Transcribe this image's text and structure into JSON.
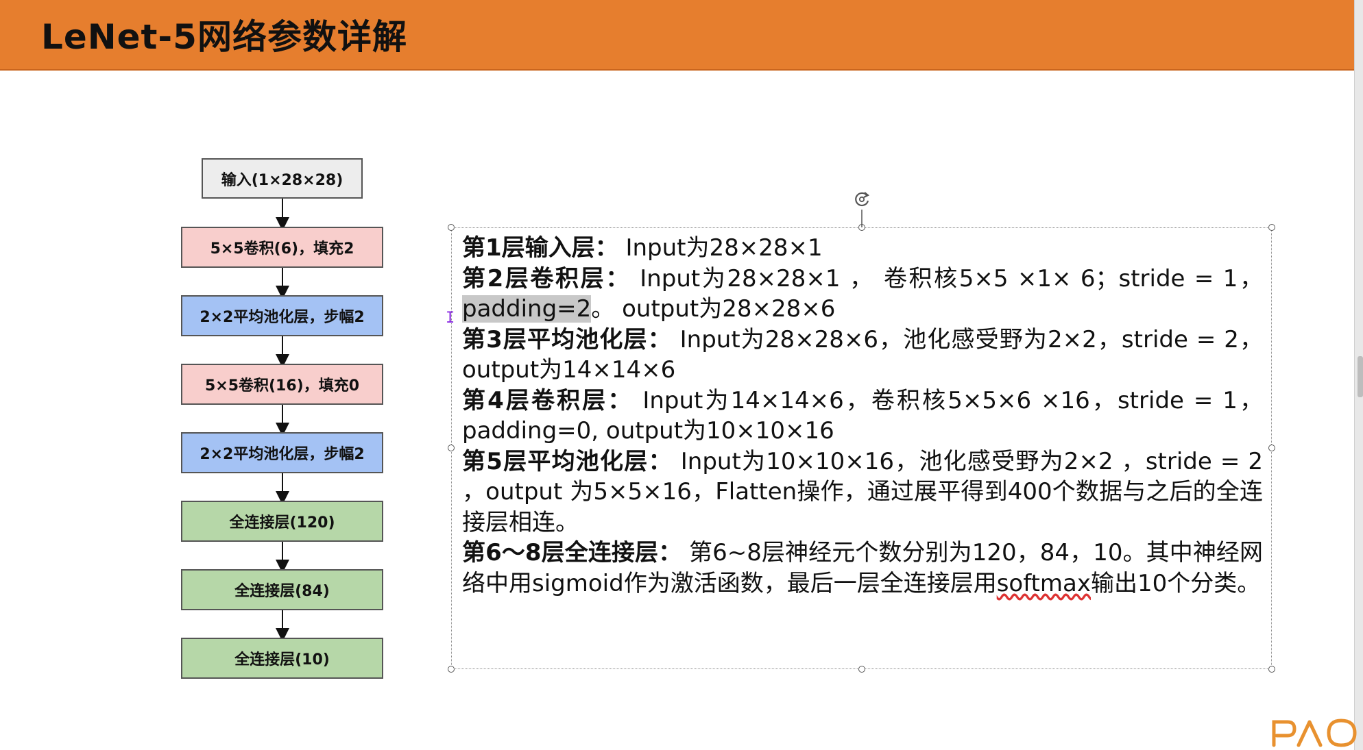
{
  "header": {
    "title": "LeNet-5网络参数详解"
  },
  "flowchart": {
    "nodes": [
      {
        "label": "输入(1×28×28)"
      },
      {
        "label": "5×5卷积(6)，填充2"
      },
      {
        "label": "2×2平均池化层，步幅2"
      },
      {
        "label": "5×5卷积(16)，填充0"
      },
      {
        "label": "2×2平均池化层，步幅2"
      },
      {
        "label": "全连接层(120)"
      },
      {
        "label": "全连接层(84)"
      },
      {
        "label": "全连接层(10)"
      }
    ],
    "colors": {
      "input": "#EDEDED",
      "conv": "#F8CECC",
      "pool": "#A4C2F4",
      "fc": "#B6D7A8",
      "header": "#E67E2E"
    }
  },
  "content": {
    "l1_head": "第1层输入层：",
    "l1_text": " Input为28×28×1",
    "l2_head": "第2层卷积层：",
    "l2_text": " Input为28×28×1 ， 卷积核5×5 ×1× 6；stride = 1，",
    "l2_highlight": "padding=2",
    "l2_text2": "。 output为28×28×6",
    "l3_head": "第3层平均池化层：",
    "l3_text": " Input为28×28×6，池化感受野为2×2，stride = 2，output为14×14×6",
    "l4_head": "第4层卷积层：",
    "l4_text": " Input为14×14×6，卷积核5×5×6 ×16，stride = 1，padding=0, output为10×10×16",
    "l5_head": "第5层平均池化层：",
    "l5_text": " Input为10×10×16，池化感受野为2×2 ，stride = 2 ，output 为5×5×16，Flatten操作，通过展平得到400个数据与之后的全连接层相连。",
    "l6_head": "第6～8层全连接层：",
    "l6_text": " 第6~8层神经元个数分别为120，84，10。其中神经网络中用sigmoid作为激活函数，最后一层全连接层用",
    "l6_squiggle": "softmax",
    "l6_text2": "输出10个分类。"
  },
  "icons": {
    "rotate": "rotate-handle-icon",
    "cursor": "text-cursor-icon",
    "logo": "pao-logo"
  }
}
